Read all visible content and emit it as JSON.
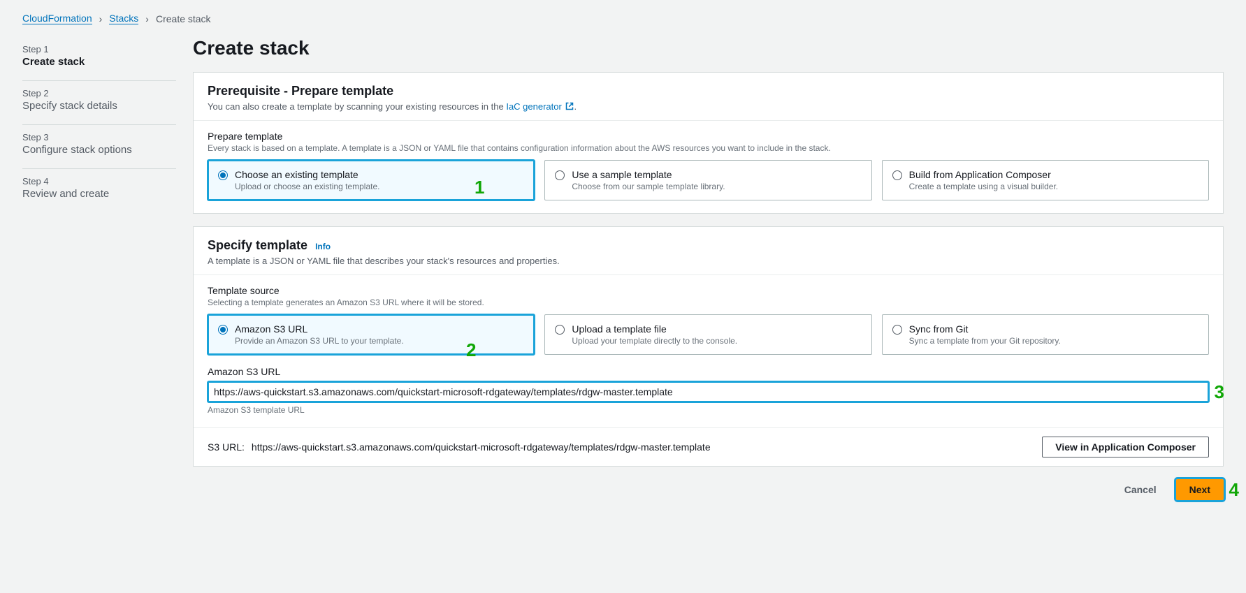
{
  "breadcrumb": {
    "root": "CloudFormation",
    "parent": "Stacks",
    "current": "Create stack"
  },
  "sidebar": {
    "steps": [
      {
        "num": "Step 1",
        "name": "Create stack",
        "active": true
      },
      {
        "num": "Step 2",
        "name": "Specify stack details",
        "active": false
      },
      {
        "num": "Step 3",
        "name": "Configure stack options",
        "active": false
      },
      {
        "num": "Step 4",
        "name": "Review and create",
        "active": false
      }
    ]
  },
  "page": {
    "title": "Create stack"
  },
  "prereq": {
    "heading": "Prerequisite - Prepare template",
    "sub_pre": "You can also create a template by scanning your existing resources in the ",
    "sub_link": "IaC generator",
    "sub_post": ".",
    "prepare_label": "Prepare template",
    "prepare_help": "Every stack is based on a template. A template is a JSON or YAML file that contains configuration information about the AWS resources you want to include in the stack.",
    "options": [
      {
        "title": "Choose an existing template",
        "desc": "Upload or choose an existing template.",
        "selected": true,
        "annot": true
      },
      {
        "title": "Use a sample template",
        "desc": "Choose from our sample template library.",
        "selected": false,
        "annot": false
      },
      {
        "title": "Build from Application Composer",
        "desc": "Create a template using a visual builder.",
        "selected": false,
        "annot": false
      }
    ]
  },
  "specify": {
    "heading": "Specify template",
    "info": "Info",
    "sub": "A template is a JSON or YAML file that describes your stack's resources and properties.",
    "source_label": "Template source",
    "source_help": "Selecting a template generates an Amazon S3 URL where it will be stored.",
    "options": [
      {
        "title": "Amazon S3 URL",
        "desc": "Provide an Amazon S3 URL to your template.",
        "selected": true,
        "annot": true
      },
      {
        "title": "Upload a template file",
        "desc": "Upload your template directly to the console.",
        "selected": false,
        "annot": false
      },
      {
        "title": "Sync from Git",
        "desc": "Sync a template from your Git repository.",
        "selected": false,
        "annot": false
      }
    ],
    "url_label": "Amazon S3 URL",
    "url_value": "https://aws-quickstart.s3.amazonaws.com/quickstart-microsoft-rdgateway/templates/rdgw-master.template",
    "url_helper": "Amazon S3 template URL",
    "s3_label": "S3 URL:",
    "s3_value": "https://aws-quickstart.s3.amazonaws.com/quickstart-microsoft-rdgateway/templates/rdgw-master.template",
    "view_composer": "View in Application Composer"
  },
  "actions": {
    "cancel": "Cancel",
    "next": "Next"
  },
  "annotations": {
    "a1": "1",
    "a2": "2",
    "a3": "3",
    "a4": "4"
  }
}
